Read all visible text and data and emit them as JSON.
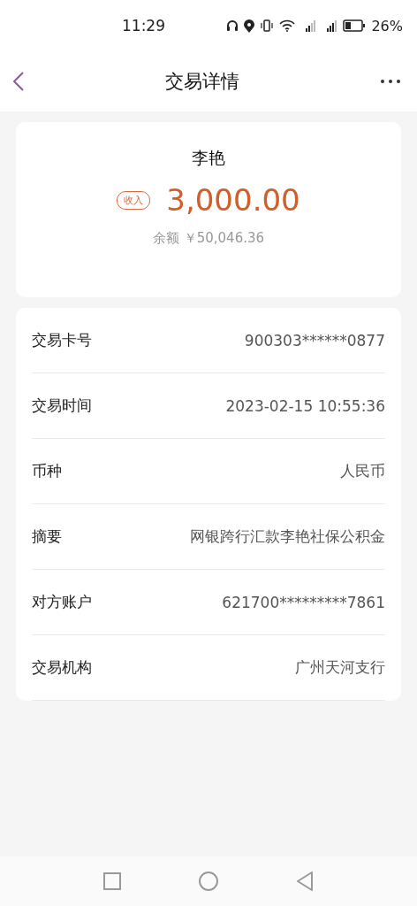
{
  "status_bar": {
    "time": "11:29",
    "battery_percent": "26%"
  },
  "header": {
    "title": "交易详情"
  },
  "summary": {
    "name": "李艳",
    "direction_tag": "收入",
    "amount": "3,000.00",
    "balance_label": "余额",
    "balance_value": "￥50,046.36"
  },
  "details": [
    {
      "label": "交易卡号",
      "value": "900303******0877"
    },
    {
      "label": "交易时间",
      "value": "2023-02-15 10:55:36"
    },
    {
      "label": "币种",
      "value": "人民币"
    },
    {
      "label": "摘要",
      "value": "网银跨行汇款李艳社保公积金"
    },
    {
      "label": "对方账户",
      "value": "621700*********7861"
    },
    {
      "label": "交易机构",
      "value": "广州天河支行"
    }
  ]
}
